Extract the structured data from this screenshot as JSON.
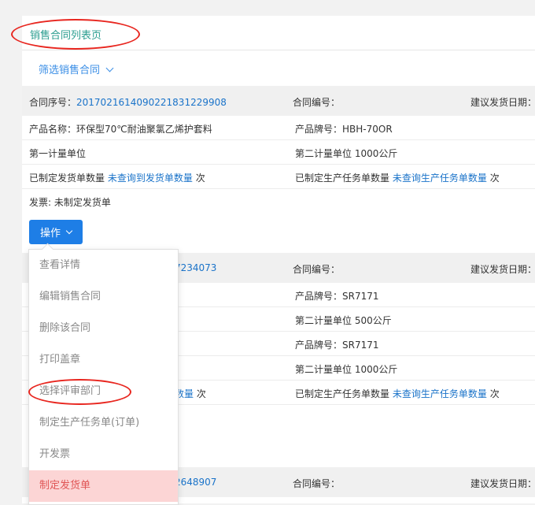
{
  "page": {
    "title": "销售合同列表页"
  },
  "filter": {
    "label": "筛选销售合同"
  },
  "labels": {
    "contract_seq": "合同序号：",
    "contract_no": "合同编号：",
    "ship_date": "建议发货日期："
  },
  "contract1": {
    "seq": "201702161409022183122990 8",
    "product_name": "产品名称：环保型70℃耐油聚氯乙烯护套料",
    "brand": "产品牌号：HBH-70OR",
    "unit1": "第一计量单位",
    "unit2": "第二计量单位 1000公斤",
    "shipped_prefix": "已制定发货单数量",
    "shipped_link": "未查询到发货单数量",
    "shipped_suffix": "次",
    "tasks_prefix": "已制定生产任务单数量",
    "tasks_link": "未查询生产任务单数量",
    "tasks_suffix": "次",
    "invoice": "发票: 未制定发货单"
  },
  "contract2": {
    "seq_tail": "7234073",
    "brand_a": "产品牌号：SR7171",
    "unit2_a": "第二计量单位 500公斤",
    "brand_b": "产品牌号：SR7171",
    "unit2_b": "第二计量单位 1000公斤",
    "shipped_link_tail": "数量",
    "shipped_suffix": "次",
    "tasks_prefix": "已制定生产任务单数量",
    "tasks_link": "未查询生产任务单数量",
    "tasks_suffix": "次"
  },
  "contract3": {
    "seq_tail": "2648907"
  },
  "operation": {
    "label": "操作"
  },
  "menu": {
    "items": [
      {
        "label": "查看详情"
      },
      {
        "label": "编辑销售合同"
      },
      {
        "label": "删除该合同"
      },
      {
        "label": "打印盖章"
      },
      {
        "label": "选择评审部门"
      },
      {
        "label": "制定生产任务单(订单)"
      },
      {
        "label": "开发票"
      },
      {
        "label": "制定发货单"
      }
    ]
  },
  "colors": {
    "accent": "#1e7ee6",
    "link": "#1a73c9",
    "title": "#2a9d8f",
    "highlight": "#e8261f"
  }
}
